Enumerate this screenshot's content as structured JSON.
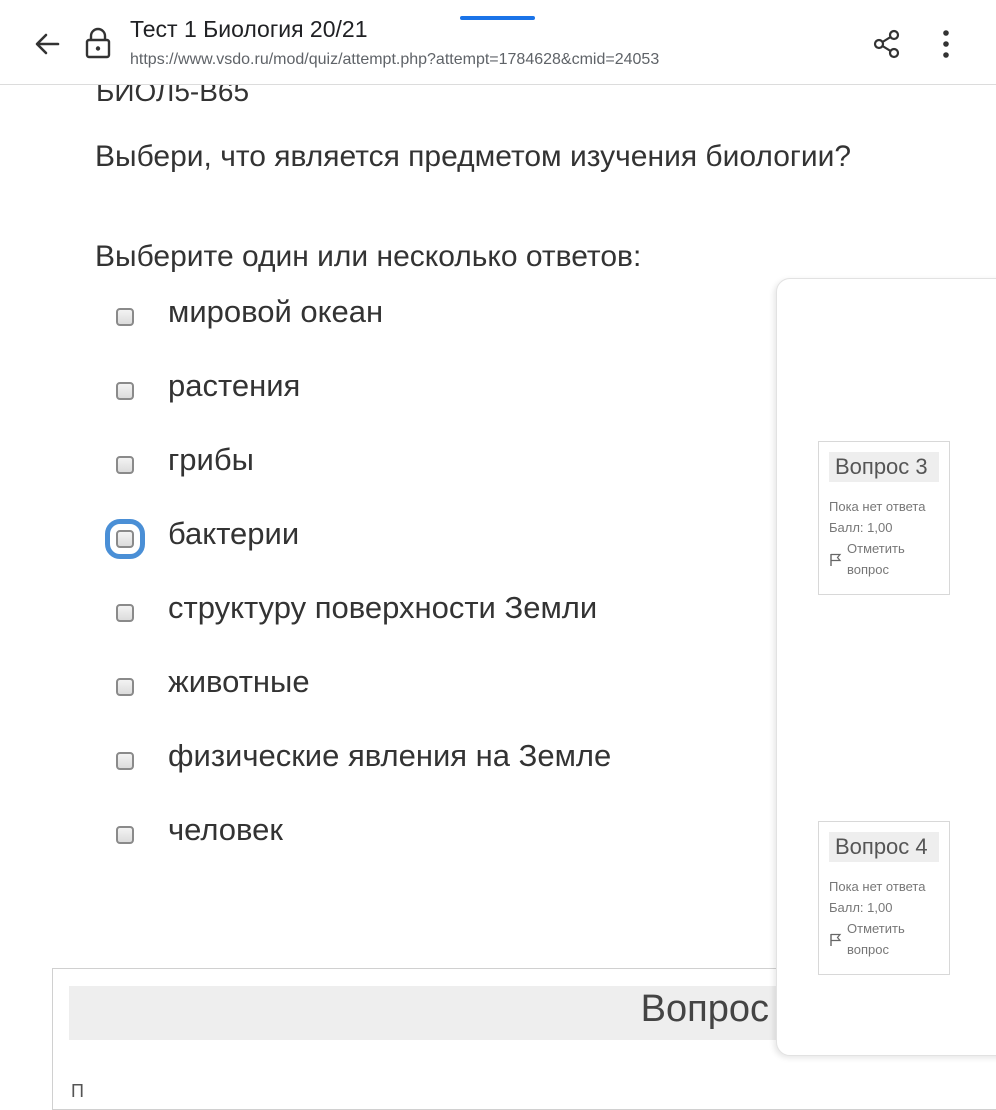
{
  "browser": {
    "title": "Тест 1 Биология 20/21",
    "url": "https://www.vsdo.ru/mod/quiz/attempt.php?attempt=1784628&cmid=24053",
    "accent": "#1a73e8"
  },
  "question": {
    "code": "БИОЛ5-В65",
    "text": "Выбери, что является предметом изучения биологии?",
    "prompt": "Выберите один или несколько ответов:",
    "answers": [
      "мировой океан",
      "растения",
      "грибы",
      "бактерии",
      "структуру поверхности Земли",
      "животные",
      "физические явления на Земле",
      "человек"
    ],
    "focused_index": 3,
    "focus_color": "#4a8fd6"
  },
  "next_question": {
    "title": "Вопрос",
    "first_letter": "П"
  },
  "nav_panel": {
    "cards": [
      {
        "title": "Вопрос 3",
        "status": "Пока нет ответа",
        "grade": "Балл: 1,00",
        "flag": "Отметить вопрос"
      },
      {
        "title": "Вопрос 4",
        "status": "Пока нет ответа",
        "grade": "Балл: 1,00",
        "flag": "Отметить вопрос"
      }
    ]
  },
  "icons": {
    "back": "back-arrow-icon",
    "lock": "lock-icon",
    "share": "share-icon",
    "menu": "more-vert-icon",
    "flag": "flag-icon"
  }
}
